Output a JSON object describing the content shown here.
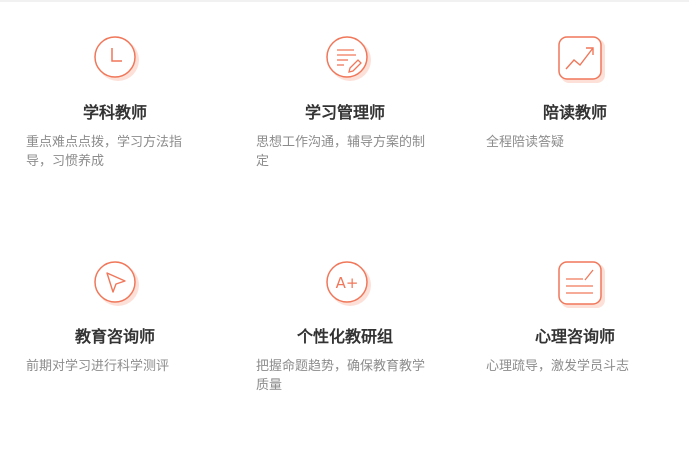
{
  "services": [
    {
      "icon": "clock-icon",
      "title": "学科教师",
      "desc": "重点难点点拨，学习方法指导，习惯养成"
    },
    {
      "icon": "document-edit-icon",
      "title": "学习管理师",
      "desc": "思想工作沟通，辅导方案的制定"
    },
    {
      "icon": "trend-chart-icon",
      "title": "陪读教师",
      "desc": "全程陪读答疑"
    },
    {
      "icon": "cursor-arrow-icon",
      "title": "教育咨询师",
      "desc": "前期对学习进行科学测评"
    },
    {
      "icon": "grade-a-plus-icon",
      "title": "个性化教研组",
      "desc": "把握命题趋势，确保教育教学质量"
    },
    {
      "icon": "notes-check-icon",
      "title": "心理咨询师",
      "desc": "心理疏导，激发学员斗志"
    }
  ],
  "icon_text": {
    "grade": "A+"
  },
  "colors": {
    "accent": "#f0775a",
    "shadow": "#fde1d9",
    "title": "#333333",
    "desc": "#8c8c8c"
  }
}
